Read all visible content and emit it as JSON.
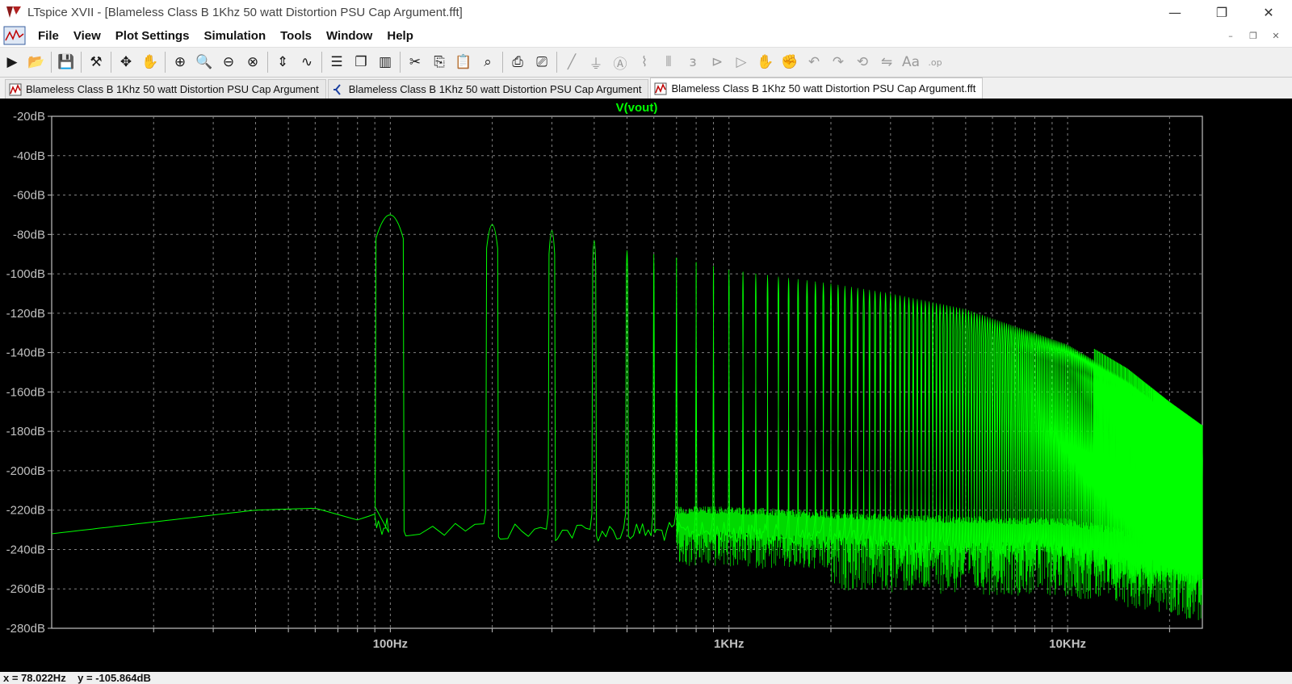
{
  "window": {
    "title": "LTspice XVII - [Blameless Class B 1Khz 50 watt Distortion PSU Cap Argument.fft]",
    "controls": [
      "minimize-icon",
      "restore-icon",
      "close-icon"
    ]
  },
  "menu": {
    "items": [
      "File",
      "View",
      "Plot Settings",
      "Simulation",
      "Tools",
      "Window",
      "Help"
    ]
  },
  "toolbar": {
    "icons": [
      "run-icon",
      "open-icon",
      "|",
      "save-icon",
      "|",
      "control-panel-icon",
      "|",
      "cursor-icon",
      "pan-icon",
      "|",
      "zoom-in-icon",
      "zoom-area-icon",
      "zoom-out-icon",
      "zoom-fit-icon",
      "|",
      "autorange-icon",
      "waveform-icon",
      "|",
      "tile-horizontal-icon",
      "cascade-icon",
      "tile-vertical-icon",
      "|",
      "cut-icon",
      "copy-icon",
      "paste-icon",
      "find-icon",
      "|",
      "print-icon",
      "print-setup-icon",
      "|",
      "wire-icon",
      "ground-icon",
      "label-icon",
      "resistor-icon",
      "capacitor-icon",
      "inductor-icon",
      "diode-icon",
      "component-icon",
      "move-icon",
      "drag-icon",
      "undo-icon",
      "redo-icon",
      "rotate-icon",
      "mirror-icon",
      "text-icon",
      "spice-directive-icon"
    ]
  },
  "tabs": [
    {
      "label": "Blameless Class B 1Khz 50 watt Distortion PSU Cap Argument",
      "icon": "waveform-tab-icon",
      "active": false
    },
    {
      "label": "Blameless Class B 1Khz 50 watt Distortion PSU Cap Argument",
      "icon": "schematic-tab-icon",
      "active": false
    },
    {
      "label": "Blameless Class B 1Khz 50 watt Distortion PSU Cap Argument.fft",
      "icon": "waveform-tab-icon",
      "active": true
    }
  ],
  "plot": {
    "trace_label": "V(vout)",
    "trace_color": "#00ff00",
    "background": "#000000",
    "grid_color": "#808080"
  },
  "chart_data": {
    "type": "line",
    "title": "V(vout)",
    "x_scale": "log",
    "xlim": [
      10,
      25000
    ],
    "ylim": [
      -280,
      -20
    ],
    "grid": true,
    "x_tick_labels": [
      "100Hz",
      "1KHz",
      "10KHz"
    ],
    "y_ticks": [
      -20,
      -40,
      -60,
      -80,
      -100,
      -120,
      -140,
      -160,
      -180,
      -200,
      -220,
      -240,
      -260,
      -280
    ],
    "y_tick_labels": [
      "-20dB",
      "-40dB",
      "-60dB",
      "-80dB",
      "-100dB",
      "-120dB",
      "-140dB",
      "-160dB",
      "-180dB",
      "-200dB",
      "-220dB",
      "-240dB",
      "-260dB",
      "-280dB"
    ],
    "series": [
      {
        "name": "V(vout)",
        "harmonic_spacing_hz": 100,
        "harmonic_peaks": [
          {
            "x": 100,
            "y": -64
          },
          {
            "x": 200,
            "y": -69
          },
          {
            "x": 300,
            "y": -72
          },
          {
            "x": 400,
            "y": -77
          },
          {
            "x": 500,
            "y": -82
          },
          {
            "x": 600,
            "y": -84
          },
          {
            "x": 700,
            "y": -86
          },
          {
            "x": 800,
            "y": -88
          },
          {
            "x": 900,
            "y": -90
          },
          {
            "x": 1000,
            "y": -92
          },
          {
            "x": 2000,
            "y": -99
          },
          {
            "x": 3000,
            "y": -104
          },
          {
            "x": 5000,
            "y": -112
          },
          {
            "x": 10000,
            "y": -130
          },
          {
            "x": 15000,
            "y": -148
          },
          {
            "x": 20000,
            "y": -165
          },
          {
            "x": 25000,
            "y": -177
          }
        ],
        "noise_floor": [
          {
            "x": 10,
            "y": -232
          },
          {
            "x": 20,
            "y": -226
          },
          {
            "x": 40,
            "y": -220
          },
          {
            "x": 60,
            "y": -219
          },
          {
            "x": 80,
            "y": -225
          },
          {
            "x": 90,
            "y": -222
          },
          {
            "x": 150,
            "y": -224
          },
          {
            "x": 300,
            "y": -226
          },
          {
            "x": 1000,
            "y": -226
          },
          {
            "x": 3000,
            "y": -230
          },
          {
            "x": 10000,
            "y": -232
          },
          {
            "x": 25000,
            "y": -245
          }
        ]
      }
    ]
  },
  "status": {
    "x_readout": "x = 78.022Hz",
    "y_readout": "y = -105.864dB"
  }
}
